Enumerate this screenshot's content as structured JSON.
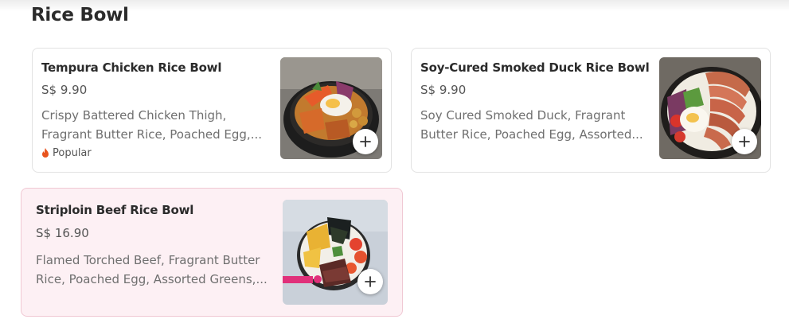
{
  "section": {
    "title": "Rice Bowl"
  },
  "items": [
    {
      "name": "Tempura Chicken Rice Bowl",
      "price": "S$ 9.90",
      "desc_line1": "Crispy Battered Chicken Thigh,",
      "desc_line2": "Fragrant Butter Rice, Poached Egg,...",
      "tag": "Popular"
    },
    {
      "name": "Soy-Cured Smoked Duck Rice Bowl",
      "price": "S$ 9.90",
      "desc_line1": "Soy Cured Smoked Duck, Fragrant",
      "desc_line2": "Butter Rice, Poached Egg, Assorted..."
    },
    {
      "name": "Striploin Beef Rice Bowl",
      "price": "S$ 16.90",
      "desc_line1": "Flamed Torched Beef, Fragrant Butter",
      "desc_line2": "Rice, Poached Egg, Assorted Greens,..."
    }
  ],
  "colors": {
    "popular_flame": "#e8541e",
    "highlight_card": "#fdf0f4"
  },
  "icons": {
    "add": "plus-icon",
    "popular": "flame-icon"
  }
}
